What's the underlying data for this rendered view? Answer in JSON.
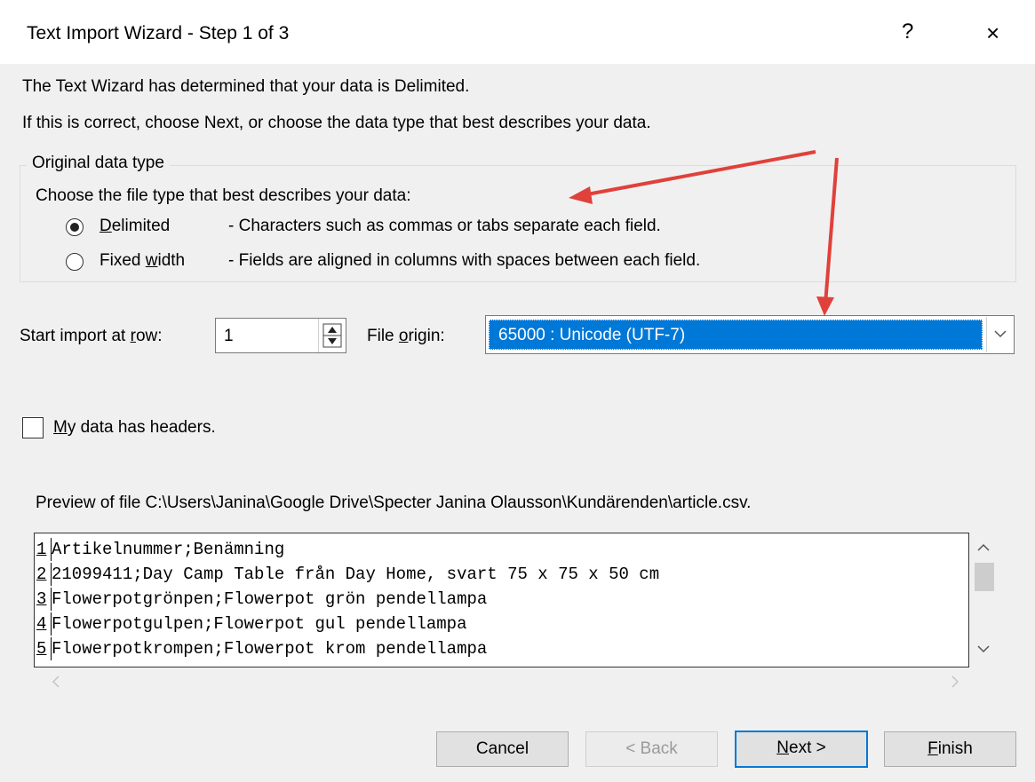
{
  "window": {
    "title": "Text Import Wizard - Step 1 of 3",
    "help_label": "?",
    "close_label": "×"
  },
  "intro": {
    "line1": "The Text Wizard has determined that your data is Delimited.",
    "line2": "If this is correct, choose Next, or choose the data type that best describes your data."
  },
  "data_type": {
    "legend": "Original data type",
    "prompt": "Choose the file type that best describes your data:",
    "options": [
      {
        "label": "Delimited",
        "description": "- Characters such as commas or tabs separate each field.",
        "selected": true
      },
      {
        "label": "Fixed width",
        "description": "- Fields are aligned in columns with spaces between each field.",
        "selected": false
      }
    ]
  },
  "start_row": {
    "label": "Start import at row:",
    "value": "1"
  },
  "file_origin": {
    "label": "File origin:",
    "value": "65000 : Unicode (UTF-7)"
  },
  "headers_checkbox": {
    "label": "My data has headers.",
    "checked": false
  },
  "preview": {
    "label": "Preview of file C:\\Users\\Janina\\Google Drive\\Specter Janina Olausson\\Kundärenden\\article.csv.",
    "rows": [
      {
        "num": "1",
        "text": "Artikelnummer;Benämning"
      },
      {
        "num": "2",
        "text": "21099411;Day Camp Table från Day Home, svart 75 x 75 x 50 cm"
      },
      {
        "num": "3",
        "text": "Flowerpotgrönpen;Flowerpot grön pendellampa"
      },
      {
        "num": "4",
        "text": "Flowerpotgulpen;Flowerpot gul pendellampa"
      },
      {
        "num": "5",
        "text": "Flowerpotkrompen;Flowerpot krom pendellampa"
      }
    ]
  },
  "buttons": {
    "cancel": "Cancel",
    "back": "< Back",
    "next": "Next >",
    "finish": "Finish"
  },
  "colors": {
    "annotation_arrow": "#e0413a",
    "selection": "#0078d7"
  }
}
